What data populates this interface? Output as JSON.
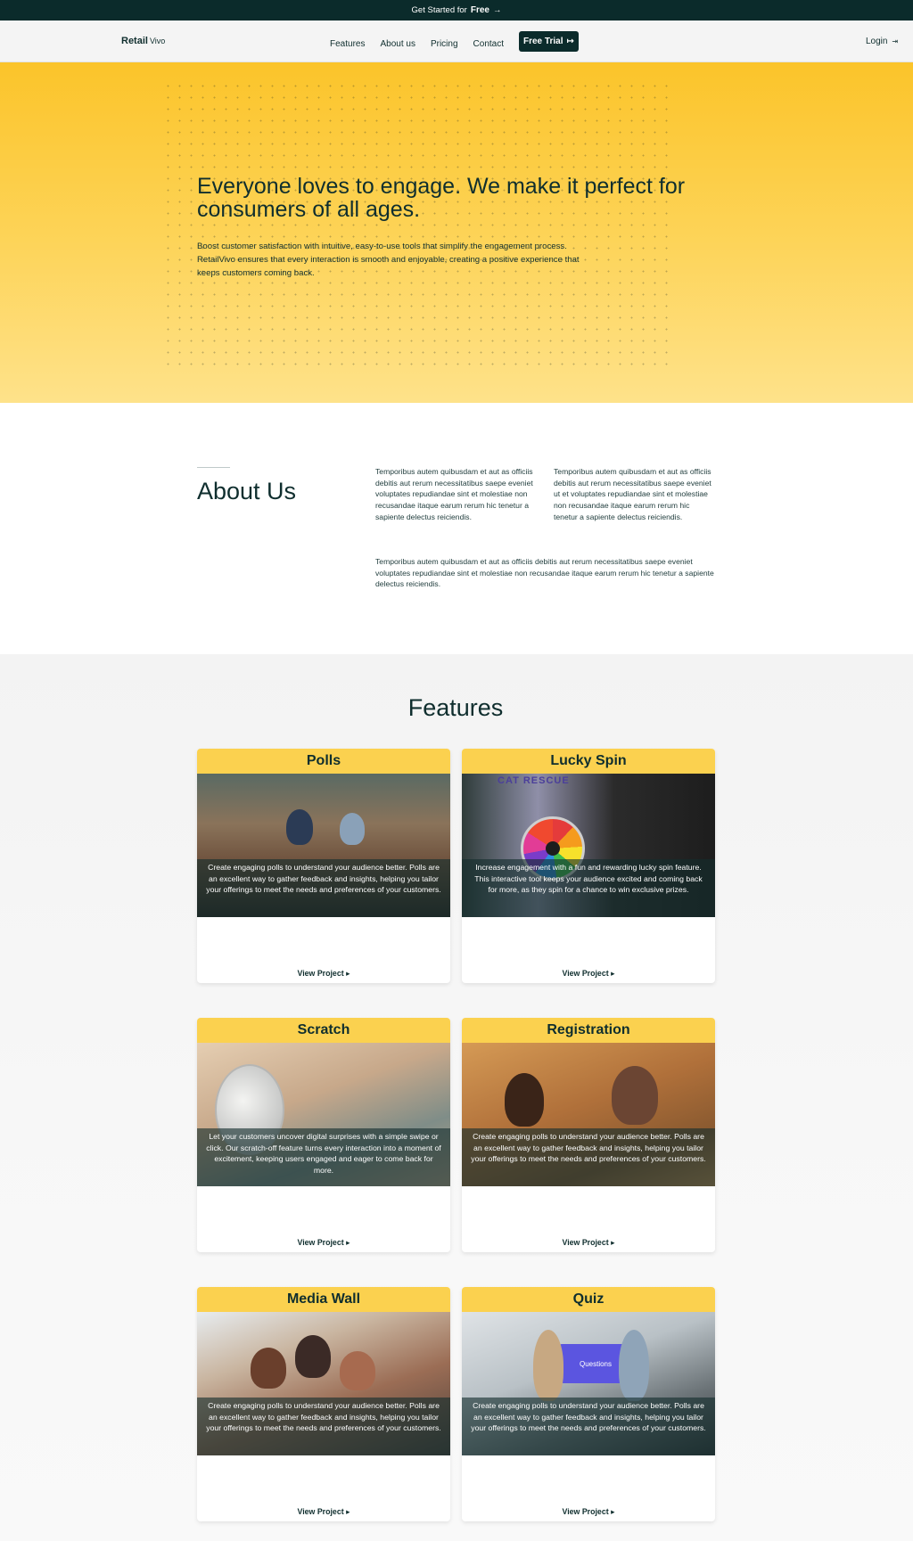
{
  "topbar": {
    "prefix": "Get Started for",
    "highlight": "Free",
    "arrow": "→"
  },
  "nav": {
    "brand_bold": "Retail",
    "brand_light": "Vivo",
    "links": [
      "Features",
      "About us",
      "Pricing",
      "Contact"
    ],
    "trial_label": "Free Trial",
    "trial_icon": "↦",
    "login_label": "Login",
    "login_icon": "⇥"
  },
  "hero": {
    "headline": "Everyone loves to engage. We make it perfect for consumers of all ages.",
    "body": "Boost customer satisfaction with intuitive, easy-to-use tools that simplify the engagement process. RetailVivo ensures that every interaction is smooth and enjoyable, creating a positive experience that keeps customers coming back."
  },
  "about": {
    "title": "About Us",
    "col1": "Temporibus autem quibusdam et aut as officiis debitis aut rerum necessitatibus saepe eveniet voluptates repudiandae sint et molestiae non recusandae itaque earum rerum hic tenetur a sapiente delectus reiciendis.",
    "col2": "Temporibus autem quibusdam et aut as officiis debitis aut rerum necessitatibus saepe eveniet ut et voluptates repudiandae sint et molestiae non recusandae itaque earum rerum hic tenetur a sapiente delectus reiciendis.",
    "col3": "Temporibus autem quibusdam et aut as officiis debitis aut rerum necessitatibus saepe eveniet voluptates repudiandae sint et molestiae non recusandae itaque earum rerum hic tenetur a sapiente delectus reiciendis."
  },
  "features": {
    "title": "Features",
    "view_label": "View Project ▸",
    "cards": [
      {
        "title": "Polls",
        "caption": "Create engaging polls to understand your audience better. Polls are an excellent way to gather feedback and insights, helping you tailor your offerings to meet the needs and preferences of your customers."
      },
      {
        "title": "Lucky Spin",
        "caption": "Increase engagement with a fun and rewarding lucky spin feature. This interactive tool keeps your audience excited and coming back for more, as they spin for a chance to win exclusive prizes."
      },
      {
        "title": "Scratch",
        "caption": "Let your customers uncover digital surprises with a simple swipe or click. Our scratch-off feature turns every interaction into a moment of excitement, keeping users engaged and eager to come back for more."
      },
      {
        "title": "Registration",
        "caption": "Create engaging polls to understand your audience better. Polls are an excellent way to gather feedback and insights, helping you tailor your offerings to meet the needs and preferences of your customers."
      },
      {
        "title": "Media Wall",
        "caption": "Create engaging polls to understand your audience better. Polls are an excellent way to gather feedback and insights, helping you tailor your offerings to meet the needs and preferences of your customers."
      },
      {
        "title": "Quiz",
        "caption": "Create engaging polls to understand your audience better. Polls are an excellent way to gather feedback and insights, helping you tailor your offerings to meet the needs and preferences of your customers."
      }
    ],
    "image_text": {
      "spin_banner": "CAT RESCUE",
      "quiz_screen": "Questions"
    }
  },
  "colors": {
    "dark": "#0b2b2b",
    "accent": "#fbd14f",
    "hero_top": "#fbc42a",
    "hero_bottom": "#fee28a"
  }
}
